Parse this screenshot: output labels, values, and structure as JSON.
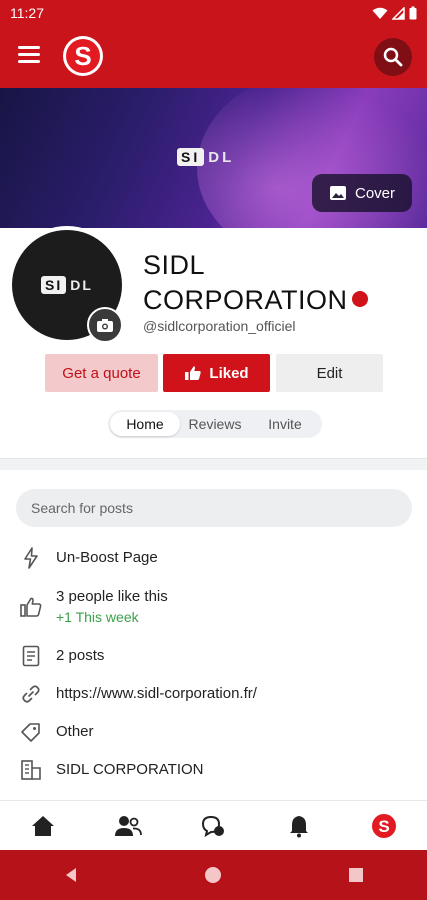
{
  "status_bar": {
    "time": "11:27"
  },
  "header": {
    "logo_letter": "S"
  },
  "cover": {
    "logo_box_text": "SI",
    "logo_tail_text": "DL",
    "cover_button_label": "Cover"
  },
  "profile": {
    "avatar_box_text": "SI",
    "avatar_tail_text": "DL",
    "name": "SIDL CORPORATION",
    "handle": "@sidlcorporation_officiel"
  },
  "actions": {
    "quote_label": "Get a quote",
    "liked_label": "Liked",
    "edit_label": "Edit"
  },
  "tabs": [
    {
      "label": "Home",
      "active": true
    },
    {
      "label": "Reviews",
      "active": false
    },
    {
      "label": "Invite",
      "active": false
    }
  ],
  "search": {
    "placeholder": "Search for posts"
  },
  "info": {
    "boost": "Un-Boost Page",
    "likes": "3 people like this",
    "likes_week": "+1 This week",
    "posts": "2 posts",
    "website": "https://www.sidl-corporation.fr/",
    "category": "Other",
    "company": "SIDL CORPORATION"
  },
  "colors": {
    "brand_red": "#d0121a",
    "status_red": "#c9141b",
    "sys_red": "#b51219",
    "green": "#3aa14a"
  }
}
